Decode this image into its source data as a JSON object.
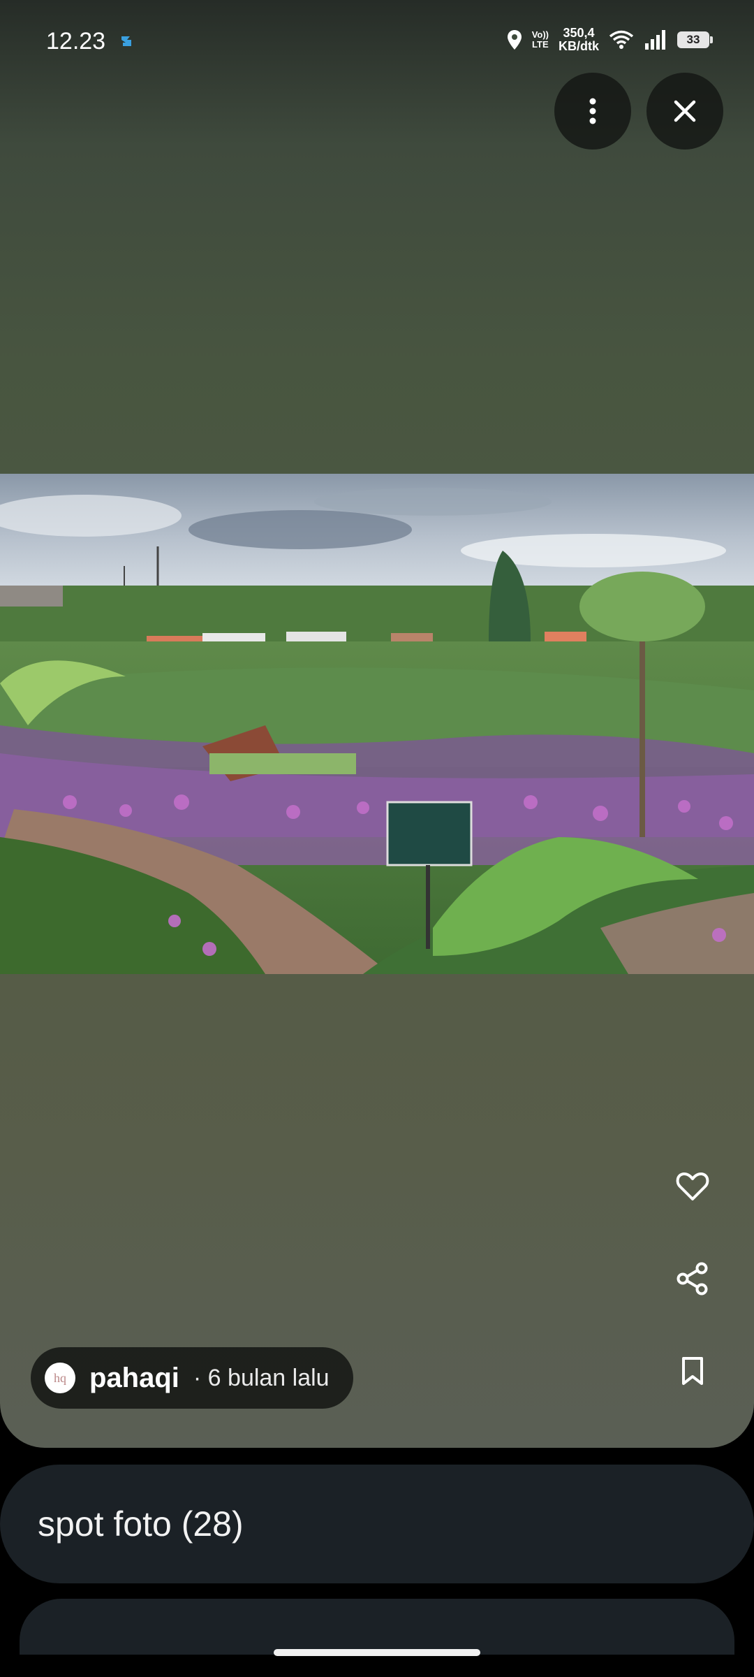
{
  "status_bar": {
    "time": "12.23",
    "volte_top": "Vo))",
    "volte_bottom": "LTE",
    "speed_value": "350,4",
    "speed_unit": "KB/dtk",
    "battery": "33"
  },
  "icons": {
    "location": "location-pin-icon",
    "wifi": "wifi-icon",
    "signal": "signal-icon",
    "more": "more-vertical-icon",
    "close": "close-icon",
    "like": "heart-icon",
    "share": "share-icon",
    "save": "bookmark-icon"
  },
  "author": {
    "avatar_initials": "hq",
    "name": "pahaqi",
    "time": "· 6 bulan lalu"
  },
  "album": {
    "title": "spot foto (28)"
  },
  "colors": {
    "card_bg": "#1b2126",
    "chip_bg": "#141614"
  }
}
